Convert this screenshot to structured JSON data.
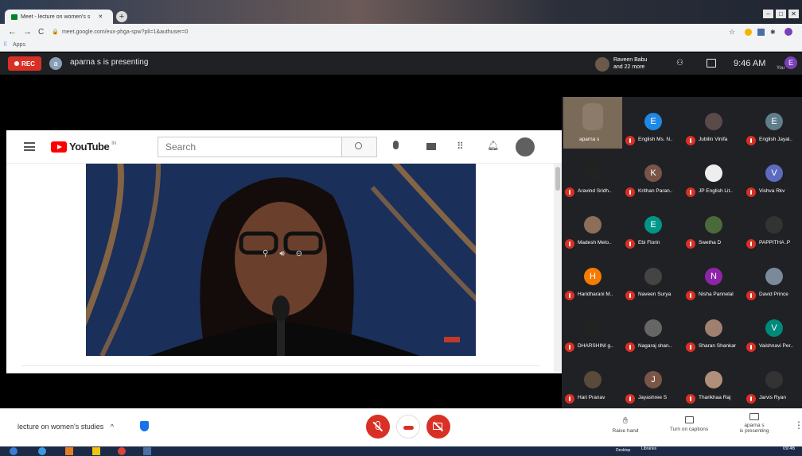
{
  "browser": {
    "tab_title": "Meet - lecture on women's s",
    "url": "meet.google.com/eux-phga-spw?pli=1&authuser=0",
    "bookmarks_label": "Apps"
  },
  "meet_top": {
    "rec_label": "REC",
    "presenter_initial": "a",
    "presenting_text": "aparna s is presenting",
    "participants_line1": "Raveen Babu",
    "participants_line2": "and 22 more",
    "time": "9:46 AM",
    "you_initial": "E",
    "you_label": "You"
  },
  "youtube": {
    "logo_text": "YouTube",
    "region": "IN",
    "search_placeholder": "Search"
  },
  "participants": [
    {
      "name": "aparna s",
      "initial": "",
      "color": "#8c7a6a",
      "muted": false
    },
    {
      "name": "English Ms. N..",
      "initial": "E",
      "color": "#1e88e5",
      "muted": true
    },
    {
      "name": "Jubilin Vinifa",
      "initial": "",
      "color": "#5a4a4a",
      "muted": true
    },
    {
      "name": "English Jayal..",
      "initial": "E",
      "color": "#607d8b",
      "muted": true
    },
    {
      "name": "Aravind Sridh..",
      "initial": "",
      "color": "#222222",
      "muted": true
    },
    {
      "name": "Krithan Paran..",
      "initial": "K",
      "color": "#795548",
      "muted": true
    },
    {
      "name": "JP English Lit..",
      "initial": "",
      "color": "#eeeeee",
      "muted": true
    },
    {
      "name": "Vishva Rkv",
      "initial": "V",
      "color": "#5c6bc0",
      "muted": true
    },
    {
      "name": "Madesh Melo..",
      "initial": "",
      "color": "#8d6e5a",
      "muted": true
    },
    {
      "name": "Ebi Florin",
      "initial": "E",
      "color": "#009688",
      "muted": true
    },
    {
      "name": "Swetha D",
      "initial": "",
      "color": "#4a6a3a",
      "muted": true
    },
    {
      "name": "PAPPITHA .P",
      "initial": "",
      "color": "#333333",
      "muted": true
    },
    {
      "name": "Haridharani M..",
      "initial": "H",
      "color": "#f57c00",
      "muted": true
    },
    {
      "name": "Naveen Surya",
      "initial": "",
      "color": "#444444",
      "muted": true
    },
    {
      "name": "Nisha Pannelal",
      "initial": "N",
      "color": "#8e24aa",
      "muted": true
    },
    {
      "name": "David Prince",
      "initial": "",
      "color": "#7a8a9a",
      "muted": true
    },
    {
      "name": "DHARSHINI g..",
      "initial": "",
      "color": "#222222",
      "muted": true
    },
    {
      "name": "Nagaraj shan..",
      "initial": "",
      "color": "#666666",
      "muted": true
    },
    {
      "name": "Sharan Shankar",
      "initial": "",
      "color": "#a08070",
      "muted": true
    },
    {
      "name": "Vaishnavi Per..",
      "initial": "V",
      "color": "#00897b",
      "muted": true
    },
    {
      "name": "Hari Pranav",
      "initial": "",
      "color": "#5a4a3a",
      "muted": true
    },
    {
      "name": "Jayashree S",
      "initial": "J",
      "color": "#795548",
      "muted": true
    },
    {
      "name": "Tharikhaa Raj",
      "initial": "",
      "color": "#b0907a",
      "muted": true
    },
    {
      "name": "Jarvis Ryan",
      "initial": "",
      "color": "#333333",
      "muted": true
    }
  ],
  "bottom": {
    "meeting_name": "lecture on women's studies",
    "raise_hand": "Raise hand",
    "captions": "Turn on captions",
    "presenting_line1": "aparna s",
    "presenting_line2": "is presenting"
  },
  "taskbar": {
    "desktop_label": "Desktop",
    "libraries_label": "Libraries",
    "time": "09:46"
  }
}
